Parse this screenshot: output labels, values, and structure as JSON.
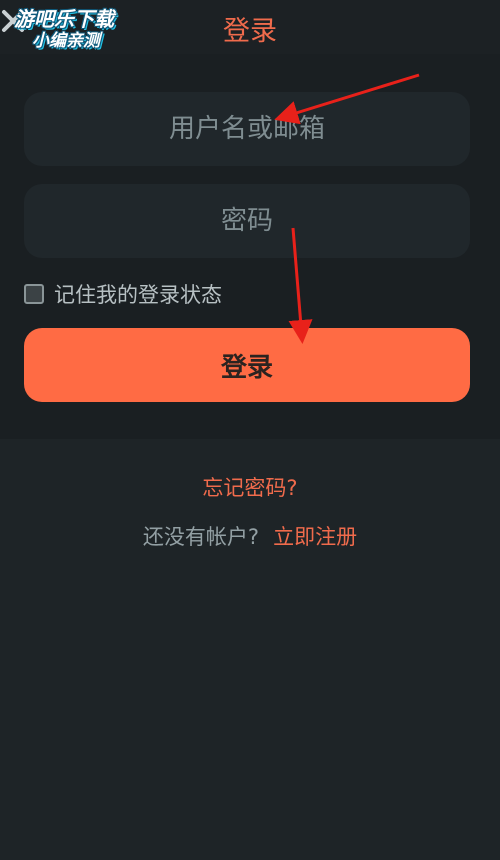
{
  "header": {
    "title": "登录",
    "close_icon": "close-icon"
  },
  "watermark": {
    "line1": "游吧乐下载",
    "line2": "小编亲测"
  },
  "form": {
    "username_placeholder": "用户名或邮箱",
    "password_placeholder": "密码",
    "remember_label": "记住我的登录状态",
    "remember_checked": false,
    "login_label": "登录"
  },
  "footer": {
    "forgot_password": "忘记密码?",
    "no_account_text": "还没有帐户?",
    "register_link": "立即注册"
  },
  "colors": {
    "accent": "#f06b4c",
    "button": "#ff6b44",
    "background": "#1e2427",
    "annotation_arrow": "#e8211a"
  }
}
